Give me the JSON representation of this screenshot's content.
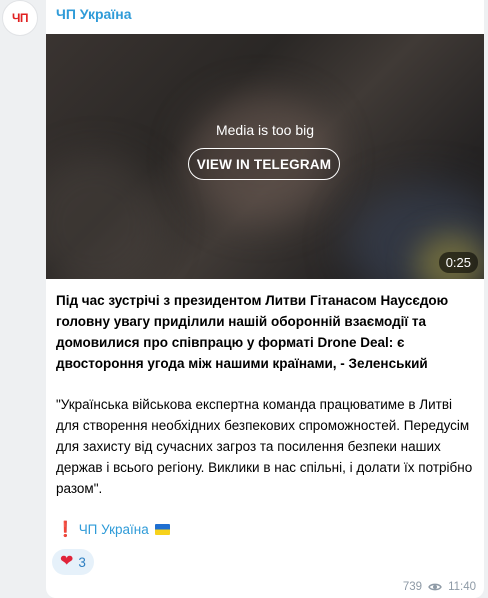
{
  "channel": {
    "avatar_text": "ЧП",
    "name": "ЧП Україна"
  },
  "media": {
    "note": "Media is too big",
    "button_label": "VIEW IN TELEGRAM",
    "duration": "0:25"
  },
  "post": {
    "headline": "Під час зустрічі з президентом Литви Гітанасом Наусєдою головну увагу приділили нашій оборонній взаємодії та домовилися про співпрацю у форматі Drone Deal: є двостороння угода між нашими країнами, - Зеленський",
    "quote": "\"Українська військова експертна команда працюватиме в Литві для створення необхідних безпекових спроможностей. Передусім для захисту від сучасних загроз та посилення безпеки наших держав і всього регіону. Виклики в нас спільні, і долати їх потрібно разом\".",
    "signature_mark": "❗",
    "signature": "ЧП Україна"
  },
  "reaction": {
    "emoji": "❤",
    "count": "3"
  },
  "footer": {
    "views": "739",
    "time": "11:40"
  },
  "icons": {
    "views": "eye-icon",
    "flag": "ukraine-flag-icon",
    "reaction": "heart-icon"
  },
  "colors": {
    "accent": "#2f9bd8",
    "avatar_text": "#e02020",
    "heart": "#e0243a",
    "meta": "#8e9aa6"
  }
}
